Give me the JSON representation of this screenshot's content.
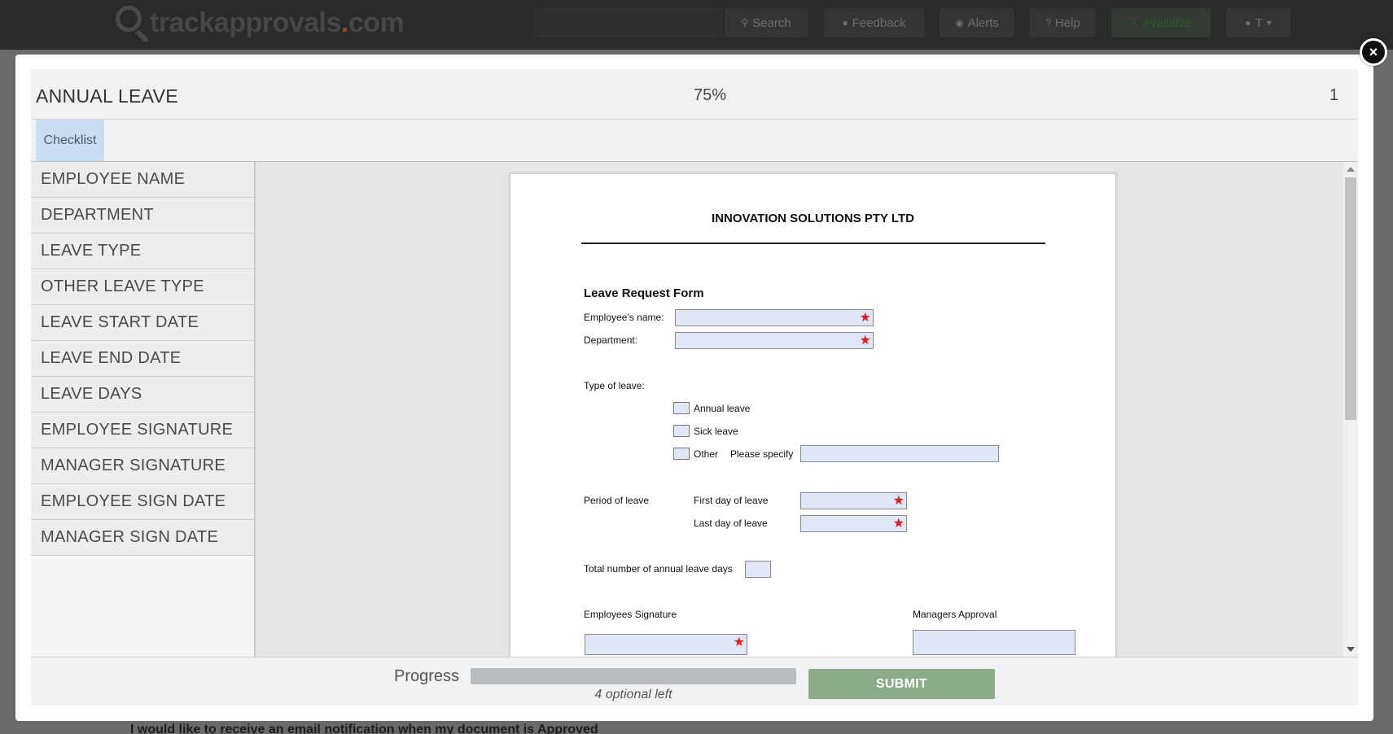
{
  "app": {
    "logo_text": "trackapprovals",
    "logo_dot": ".",
    "logo_suffix": "com",
    "nav": {
      "search": "Search",
      "feedback": "Feedback",
      "alerts": "Alerts",
      "help": "Help",
      "status": "Available",
      "user": "T"
    },
    "background_text": "I would like to receive an email notification when my document is Approved"
  },
  "modal": {
    "title": "ANNUAL LEAVE",
    "zoom": "75%",
    "page_number": "1",
    "close_icon": "×",
    "tabs": [
      "Checklist"
    ],
    "checklist": [
      "EMPLOYEE NAME",
      "DEPARTMENT",
      "LEAVE TYPE",
      "OTHER LEAVE TYPE",
      "LEAVE START DATE",
      "LEAVE END DATE",
      "LEAVE DAYS",
      "EMPLOYEE SIGNATURE",
      "MANAGER SIGNATURE",
      "EMPLOYEE SIGN DATE",
      "MANAGER SIGN DATE"
    ],
    "footer": {
      "progress_label": "Progress",
      "progress_fraction": 0.0,
      "optional_left": "4 optional left",
      "submit_label": "SUBMIT"
    }
  },
  "document": {
    "company": "INNOVATION SOLUTIONS PTY LTD",
    "heading": "Leave Request Form",
    "employee_name_label": "Employee’s name:",
    "department_label": "Department:",
    "type_of_leave_label": "Type of leave:",
    "leave_options": [
      "Annual leave",
      "Sick leave",
      "Other"
    ],
    "please_specify": "Please specify",
    "period_label": "Period of leave",
    "first_day_label": "First day of leave",
    "last_day_label": "Last day of leave",
    "total_days_label": "Total number of annual leave days",
    "employee_signature_label": "Employees Signature",
    "manager_approval_label": "Managers Approval",
    "required_icon": "★"
  },
  "colors": {
    "header_bg": "#2a2a2a",
    "field_bg": "#dfe7f7",
    "required_star": "#e21b1b",
    "tab_active": "#c9dff1",
    "submit_bg": "#8bab8b"
  }
}
